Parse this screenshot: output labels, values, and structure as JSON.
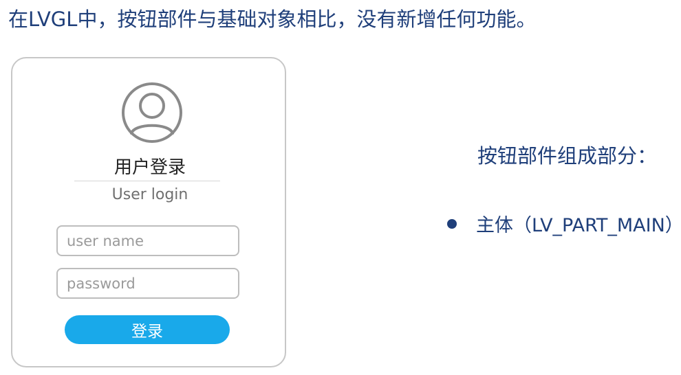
{
  "headline": "在LVGL中，按钮部件与基础对象相比，没有新增任何功能。",
  "login_card": {
    "title": "用户登录",
    "subtitle": "User login",
    "username_placeholder": "user name",
    "password_placeholder": "password",
    "login_button_label": "登录",
    "avatar_icon": "user-avatar-icon"
  },
  "components": {
    "title": "按钮部件组成部分：",
    "items": [
      {
        "label": "主体（LV_PART_MAIN）"
      }
    ]
  },
  "colors": {
    "text_blue": "#1f3f7a",
    "button_blue": "#19a9ea",
    "card_border": "#c7c7c7",
    "icon_gray": "#8a8a8a"
  }
}
